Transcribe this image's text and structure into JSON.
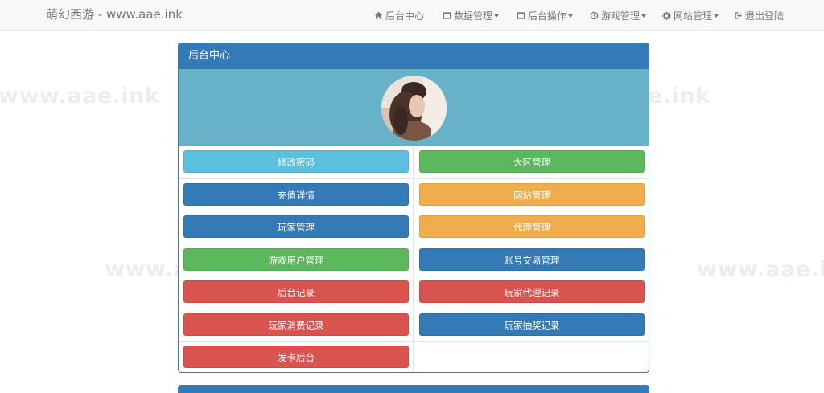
{
  "brand": "萌幻西游 - www.aae.ink",
  "nav": [
    {
      "label": "后台中心",
      "icon": "home-icon",
      "dropdown": false
    },
    {
      "label": "数据管理",
      "icon": "window-icon",
      "dropdown": true
    },
    {
      "label": "后台操作",
      "icon": "window-icon",
      "dropdown": true
    },
    {
      "label": "游戏管理",
      "icon": "clock-icon",
      "dropdown": true
    },
    {
      "label": "网站管理",
      "icon": "gear-icon",
      "dropdown": true
    },
    {
      "label": "退出登陆",
      "icon": "logout-icon",
      "dropdown": false
    }
  ],
  "watermark": "www.aae.ink",
  "panel": {
    "title": "后台中心"
  },
  "buttons": [
    {
      "label": "修改密码",
      "color": "#5bc0de"
    },
    {
      "label": "大区管理",
      "color": "#5cb85c"
    },
    {
      "label": "充值详情",
      "color": "#337ab7"
    },
    {
      "label": "网站管理",
      "color": "#f0ad4e"
    },
    {
      "label": "玩家管理",
      "color": "#337ab7"
    },
    {
      "label": "代理管理",
      "color": "#f0ad4e"
    },
    {
      "label": "游戏用户管理",
      "color": "#5cb85c"
    },
    {
      "label": "账号交易管理",
      "color": "#337ab7"
    },
    {
      "label": "后台记录",
      "color": "#d9534f"
    },
    {
      "label": "玩家代理记录",
      "color": "#d9534f"
    },
    {
      "label": "玩家消费记录",
      "color": "#d9534f"
    },
    {
      "label": "玩家抽奖记录",
      "color": "#337ab7"
    },
    {
      "label": "发卡后台",
      "color": "#d9534f"
    }
  ]
}
